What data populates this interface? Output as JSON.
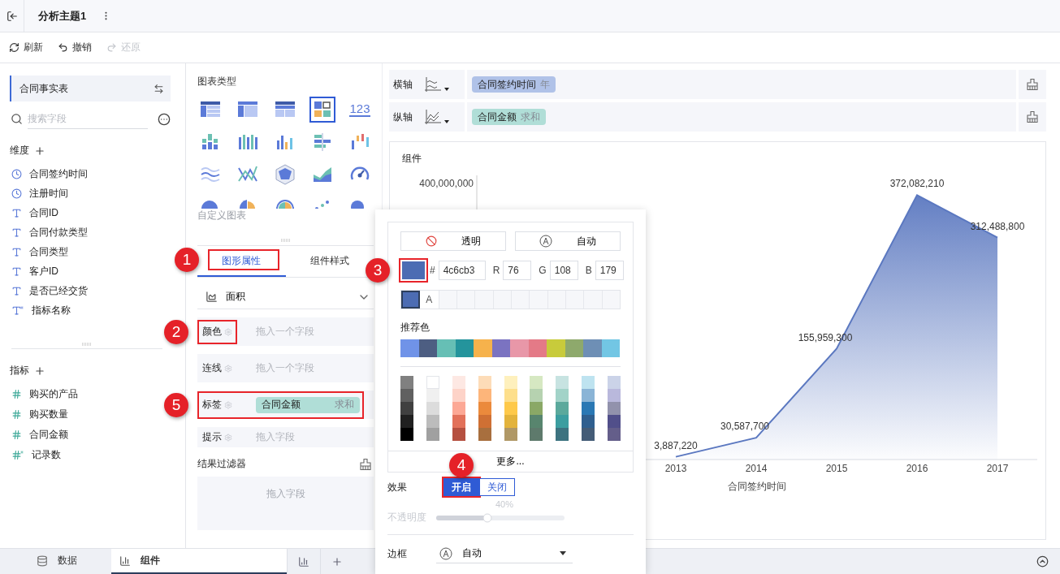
{
  "header": {
    "title": "分析主题1"
  },
  "toolbar": [
    {
      "label": "刷新",
      "kind": "refresh",
      "disabled": false
    },
    {
      "label": "撤销",
      "kind": "undo",
      "disabled": false
    },
    {
      "label": "还原",
      "kind": "redo",
      "disabled": true
    }
  ],
  "data_panel": {
    "table": "合同事实表",
    "search": {
      "placeholder": "搜索字段"
    },
    "dimensions": {
      "title": "维度",
      "fields": [
        {
          "name": "合同签约时间",
          "kind": "date"
        },
        {
          "name": "注册时间",
          "kind": "date"
        },
        {
          "name": "合同ID",
          "kind": "text"
        },
        {
          "name": "合同付款类型",
          "kind": "text"
        },
        {
          "name": "合同类型",
          "kind": "text"
        },
        {
          "name": "客户ID",
          "kind": "text"
        },
        {
          "name": "是否已经交货",
          "kind": "text"
        },
        {
          "name": "指标名称",
          "kind": "text_calc"
        }
      ]
    },
    "measures": {
      "title": "指标",
      "fields": [
        {
          "name": "购买的产品",
          "kind": "number"
        },
        {
          "name": "购买数量",
          "kind": "number"
        },
        {
          "name": "合同金额",
          "kind": "number"
        },
        {
          "name": "记录数",
          "kind": "number_calc"
        }
      ]
    }
  },
  "chart_types": {
    "title": "图表类型",
    "custom": "自定义图表",
    "items": [
      {
        "kind": "table",
        "selected": false
      },
      {
        "kind": "cross_table",
        "selected": false
      },
      {
        "kind": "detail_table",
        "selected": false
      },
      {
        "kind": "layout",
        "selected": true
      },
      {
        "kind": "number",
        "label": "123",
        "selected": false
      },
      {
        "kind": "stacked_bar",
        "selected": false
      },
      {
        "kind": "grouped_bar",
        "selected": false
      },
      {
        "kind": "bar",
        "selected": false
      },
      {
        "kind": "hbar",
        "selected": false
      },
      {
        "kind": "range_bar",
        "selected": false
      },
      {
        "kind": "wave",
        "selected": false
      },
      {
        "kind": "cross_line",
        "selected": false
      },
      {
        "kind": "radar",
        "selected": false
      },
      {
        "kind": "area",
        "selected": false
      },
      {
        "kind": "gauge",
        "selected": false
      },
      {
        "kind": "pie",
        "selected": false
      },
      {
        "kind": "rose",
        "selected": false
      },
      {
        "kind": "polar",
        "selected": false
      },
      {
        "kind": "scatter",
        "selected": false
      },
      {
        "kind": "bubble",
        "selected": false
      }
    ]
  },
  "properties": {
    "tabs": [
      {
        "label": "图形属性",
        "selected": true,
        "step": "1"
      },
      {
        "label": "组件样式",
        "selected": false
      }
    ],
    "chart_kind": "面积",
    "rows": [
      {
        "label": "颜色",
        "placeholder": "拖入一个字段",
        "step": "2"
      },
      {
        "label": "连线",
        "placeholder": "拖入一个字段"
      },
      {
        "label": "标签",
        "field": {
          "name": "合同金额",
          "agg": "求和"
        },
        "step": "5"
      },
      {
        "label": "提示",
        "placeholder": "拖入字段"
      }
    ],
    "filter": {
      "title": "结果过滤器",
      "placeholder": "拖入字段"
    }
  },
  "axes": [
    {
      "label": "横轴",
      "kind": "x",
      "field": {
        "name": "合同签约时间",
        "agg": "年",
        "color": "#b0c2e8"
      }
    },
    {
      "label": "纵轴",
      "kind": "y",
      "field": {
        "name": "合同金额",
        "agg": "求和",
        "color": "#b0ded7"
      }
    }
  ],
  "chart": {
    "title": "组件",
    "y_tick_label": "400,000,000",
    "chart_data": {
      "type": "area",
      "xlabel": "合同签约时间",
      "categories": [
        "2013",
        "2014",
        "2015",
        "2016",
        "2017"
      ],
      "values": [
        3887220,
        30587700,
        155959300,
        372082210,
        312488800
      ],
      "value_labels": [
        "3,887,220",
        "30,587,700",
        "155,959,300",
        "372,082,210",
        "312,488,800"
      ]
    }
  },
  "color_picker": {
    "buttons": [
      {
        "label": "透明",
        "kind": "none"
      },
      {
        "label": "自动",
        "kind": "auto"
      }
    ],
    "current": {
      "color": "#4c6cb3",
      "hash": "#",
      "hex": "4c6cb3",
      "step": "3",
      "channels": [
        {
          "label": "R",
          "value": "76"
        },
        {
          "label": "G",
          "value": "108"
        },
        {
          "label": "B",
          "value": "179"
        }
      ]
    },
    "recent": [
      {
        "color": "#4c6cb3",
        "selected": true
      }
    ],
    "recent_auto": "A",
    "recommended_title": "推荐色",
    "recommended": [
      {
        "color": "#7093e8"
      },
      {
        "color": "#4d5e82"
      },
      {
        "color": "#66bfb5"
      },
      {
        "color": "#24949c"
      },
      {
        "color": "#f6b24c"
      },
      {
        "color": "#7b73c1"
      },
      {
        "color": "#e897a8"
      },
      {
        "color": "#e47a87"
      },
      {
        "color": "#c8cb3b"
      },
      {
        "color": "#8ea96c"
      },
      {
        "color": "#6e8fb5"
      },
      {
        "color": "#72c6e4"
      }
    ],
    "palette": [
      {
        "shades": [
          {
            "color": "#808080"
          },
          {
            "color": "#606060"
          },
          {
            "color": "#404040"
          },
          {
            "color": "#202020"
          },
          {
            "color": "#000000"
          }
        ]
      },
      {
        "shades": [
          {
            "color": "#ffffff"
          },
          {
            "color": "#f0f0f0"
          },
          {
            "color": "#dcdcdc"
          },
          {
            "color": "#bcbcbc"
          },
          {
            "color": "#a0a0a0"
          }
        ]
      },
      {
        "shades": [
          {
            "color": "#fde8e3"
          },
          {
            "color": "#fdd3c8"
          },
          {
            "color": "#fca895"
          },
          {
            "color": "#e2715a"
          },
          {
            "color": "#b55040"
          }
        ]
      },
      {
        "shades": [
          {
            "color": "#fddcb8"
          },
          {
            "color": "#fdb57a"
          },
          {
            "color": "#eb8a3c"
          },
          {
            "color": "#cf7034"
          },
          {
            "color": "#a86f3e"
          }
        ]
      },
      {
        "shades": [
          {
            "color": "#fef0bd"
          },
          {
            "color": "#fddf8c"
          },
          {
            "color": "#fec94a"
          },
          {
            "color": "#e3b33c"
          },
          {
            "color": "#b09866"
          }
        ]
      },
      {
        "shades": [
          {
            "color": "#d6e8c2"
          },
          {
            "color": "#b6d2b0"
          },
          {
            "color": "#8aa866"
          },
          {
            "color": "#58856e"
          },
          {
            "color": "#5e7a6c"
          }
        ]
      },
      {
        "shades": [
          {
            "color": "#c7e3e1"
          },
          {
            "color": "#a2d3c8"
          },
          {
            "color": "#5ba99c"
          },
          {
            "color": "#3c9ea0"
          },
          {
            "color": "#3d7380"
          }
        ]
      },
      {
        "shades": [
          {
            "color": "#bee3f0"
          },
          {
            "color": "#8ab4d6"
          },
          {
            "color": "#2a78b4"
          },
          {
            "color": "#2f5f8f"
          },
          {
            "color": "#445c77"
          }
        ]
      },
      {
        "shades": [
          {
            "color": "#cbd3e8"
          },
          {
            "color": "#b9b8dc"
          },
          {
            "color": "#9292ac"
          },
          {
            "color": "#514f8a"
          },
          {
            "color": "#645e8a"
          }
        ]
      }
    ],
    "more": "更多...",
    "effect": {
      "label": "效果",
      "options": [
        {
          "label": "开启",
          "selected": true,
          "step": "4"
        },
        {
          "label": "关闭",
          "selected": false
        }
      ]
    },
    "opacity": {
      "label": "不透明度",
      "reading": "40%",
      "level": 0.4,
      "disabled": true
    },
    "border": {
      "label": "边框",
      "value": "自动"
    }
  },
  "bottom_tabs": [
    {
      "label": "数据",
      "kind": "data",
      "selected": false
    },
    {
      "label": "组件",
      "kind": "chart",
      "selected": true
    }
  ]
}
